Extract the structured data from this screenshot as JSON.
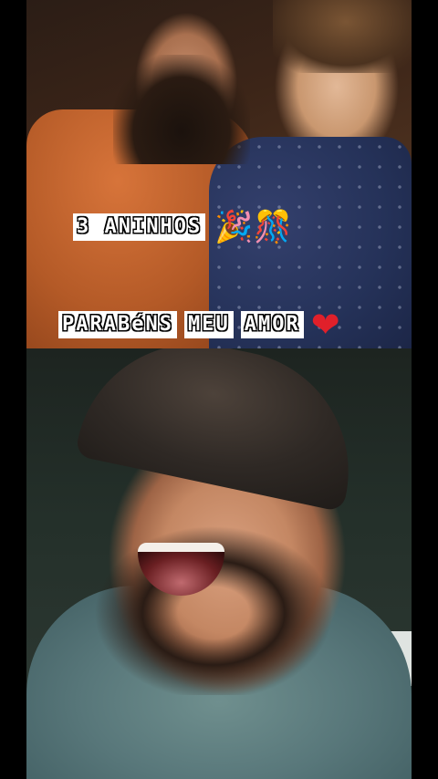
{
  "top_photo": {
    "caption_line_1": {
      "text": "3 ANINHOS",
      "emojis": "🎉🎊"
    },
    "caption_line_2": {
      "words": [
        "PARABéNS",
        "MEU",
        "AMOR"
      ],
      "heart": "❤"
    }
  },
  "colors": {
    "background": "#000000",
    "caption_plate": "#ffffff",
    "caption_outline": "#000000",
    "heart": "#e0202a"
  }
}
